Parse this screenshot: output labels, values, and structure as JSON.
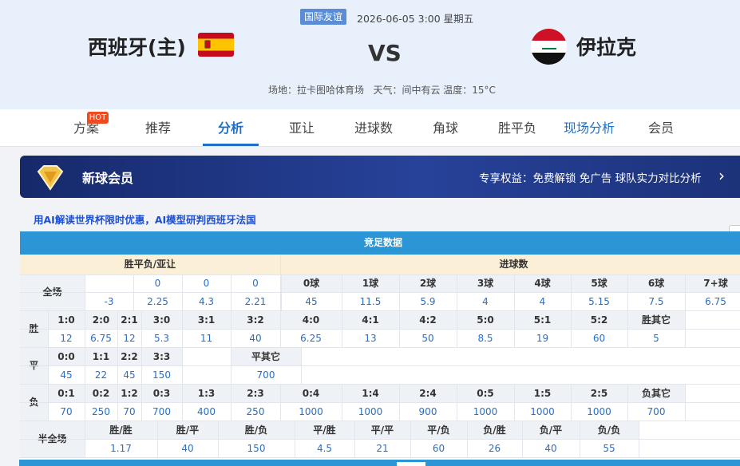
{
  "match": {
    "competition": "国际友谊",
    "datetime": "2026-06-05 3:00 星期五",
    "home": "西班牙(主)",
    "away": "伊拉克",
    "vs": "VS",
    "venue": "场地：拉卡图哈体育场",
    "weather": "天气：间中有云 温度：15°C",
    "home_flag": "spain-flag-icon",
    "away_flag": "iraq-flag-icon"
  },
  "nav": {
    "hot": "HOT",
    "items": [
      "方案",
      "推荐",
      "分析",
      "亚让",
      "进球数",
      "角球",
      "胜平负",
      "现场分析",
      "会员"
    ],
    "active": "分析",
    "highlight": "现场分析"
  },
  "vip": {
    "title": "新球会员",
    "perks": "专享权益：免费解锁 免广告 球队实力对比分析",
    "arrow": "›"
  },
  "promo": "用AI解读世界杯限时优惠，AI模型研判西班牙法国",
  "table": {
    "title": "竞足数据",
    "hdr_wdl": "胜平负/亚让",
    "hdr_goals": "进球数",
    "full": {
      "label": "全场",
      "top": [
        "",
        "0",
        "0",
        "0"
      ],
      "bottom": [
        "-3",
        "2.25",
        "4.3",
        "2.21"
      ]
    },
    "goals": {
      "labels": [
        "0球",
        "1球",
        "2球",
        "3球",
        "4球",
        "5球",
        "6球",
        "7+球"
      ],
      "odds": [
        "45",
        "11.5",
        "5.9",
        "4",
        "4",
        "5.15",
        "7.5",
        "6.75"
      ]
    },
    "win": {
      "label": "胜",
      "scores": [
        "1:0",
        "2:0",
        "2:1",
        "3:0",
        "3:1",
        "3:2",
        "4:0",
        "4:1",
        "4:2",
        "5:0",
        "5:1",
        "5:2",
        "胜其它"
      ],
      "odds": [
        "12",
        "6.75",
        "12",
        "5.3",
        "11",
        "40",
        "6.25",
        "13",
        "50",
        "8.5",
        "19",
        "60",
        "5"
      ]
    },
    "draw": {
      "label": "平",
      "scores": [
        "0:0",
        "1:1",
        "2:2",
        "3:3",
        "平其它"
      ],
      "odds": [
        "45",
        "22",
        "45",
        "150",
        "700"
      ]
    },
    "lose": {
      "label": "负",
      "scores": [
        "0:1",
        "0:2",
        "1:2",
        "0:3",
        "1:3",
        "2:3",
        "0:4",
        "1:4",
        "2:4",
        "0:5",
        "1:5",
        "2:5",
        "负其它"
      ],
      "odds": [
        "70",
        "250",
        "70",
        "700",
        "400",
        "250",
        "1000",
        "1000",
        "900",
        "1000",
        "1000",
        "1000",
        "700"
      ]
    },
    "half": {
      "label": "半全场",
      "labels": [
        "胜/胜",
        "胜/平",
        "胜/负",
        "平/胜",
        "平/平",
        "平/负",
        "负/胜",
        "负/平",
        "负/负"
      ],
      "odds": [
        "1.17",
        "40",
        "150",
        "4.5",
        "21",
        "60",
        "26",
        "40",
        "55"
      ]
    }
  },
  "colors": {
    "header_bg": "#e8f0fb",
    "accent": "#1f6fc9",
    "table_title": "#2b95d6",
    "vip_bg": "#1c3279",
    "promo": "#1d4fd1"
  }
}
